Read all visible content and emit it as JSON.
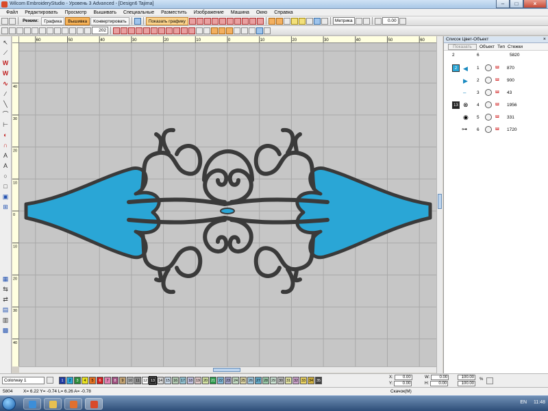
{
  "window": {
    "title": "Wilcom EmbroideryStudio - Уровень 3 Advanced - [Design6 Tajima]"
  },
  "menu": [
    "Файл",
    "Редактировать",
    "Просмотр",
    "Вышивать",
    "Специальные",
    "Разместить",
    "Изображение",
    "Машина",
    "Окно",
    "Справка"
  ],
  "toolbar1": {
    "mode_label": "Режим:",
    "mode_graphics": "Графика",
    "mode_embroidery": "Вышивка",
    "convert": "Конвертировать",
    "show_graphics": "Показать графику",
    "units": "Метрика",
    "value": "0.00"
  },
  "toolbar2": {
    "zoom": "202"
  },
  "ruler": {
    "h_labels": [
      "-70",
      "-60",
      "-50",
      "-40",
      "-30",
      "-20",
      "-10",
      "0",
      "10",
      "20",
      "30",
      "40",
      "50",
      "60",
      "70"
    ],
    "v_labels": [
      "-40",
      "-30",
      "-20",
      "-10",
      "0",
      "10",
      "20",
      "30",
      "40",
      "50",
      "60"
    ]
  },
  "docker": {
    "title": "Список Цвет-Объект",
    "show_button": "Показать",
    "col_object": "Объект",
    "col_type": "Тип",
    "col_stitches": "Стежки",
    "total_count": "2",
    "total_objects": "6",
    "total_stitches": "5820",
    "groups": [
      {
        "color_num": "2",
        "color": "#2aa6d6",
        "items": [
          {
            "num": "1",
            "stitches": "870"
          },
          {
            "num": "2",
            "stitches": "900"
          },
          {
            "num": "3",
            "stitches": "43"
          }
        ]
      },
      {
        "color_num": "13",
        "color": "#222222",
        "items": [
          {
            "num": "4",
            "stitches": "1956"
          },
          {
            "num": "5",
            "stitches": "331"
          },
          {
            "num": "6",
            "stitches": "1720"
          }
        ]
      }
    ]
  },
  "colorbar": {
    "colorway": "Colorway 1",
    "swatches": [
      {
        "n": "1",
        "c": "#1f3aa0"
      },
      {
        "n": "2",
        "c": "#2aa6d6"
      },
      {
        "n": "3",
        "c": "#2d8a3a"
      },
      {
        "n": "4",
        "c": "#e8e020"
      },
      {
        "n": "5",
        "c": "#e07020"
      },
      {
        "n": "6",
        "c": "#d02020"
      },
      {
        "n": "7",
        "c": "#e080b0"
      },
      {
        "n": "8",
        "c": "#a05080"
      },
      {
        "n": "9",
        "c": "#c0a070"
      },
      {
        "n": "10",
        "c": "#b0b0b0"
      },
      {
        "n": "11",
        "c": "#909090"
      },
      {
        "n": "12",
        "c": "#ffffff"
      },
      {
        "n": "13",
        "c": "#222222"
      },
      {
        "n": "14",
        "c": "#d8d8d8"
      },
      {
        "n": "15",
        "c": "#c8d8e8"
      },
      {
        "n": "16",
        "c": "#b0c8b0"
      },
      {
        "n": "17",
        "c": "#90c0d0"
      },
      {
        "n": "18",
        "c": "#c0c0e0"
      },
      {
        "n": "19",
        "c": "#e0c8c8"
      },
      {
        "n": "20",
        "c": "#d0e0a0"
      },
      {
        "n": "21",
        "c": "#2a9a4a"
      },
      {
        "n": "22",
        "c": "#80b8d8"
      },
      {
        "n": "23",
        "c": "#a0a0c8"
      },
      {
        "n": "24",
        "c": "#c0d8c0"
      },
      {
        "n": "25",
        "c": "#d8d0a0"
      },
      {
        "n": "26",
        "c": "#a0c8e0"
      },
      {
        "n": "27",
        "c": "#60a8c8"
      },
      {
        "n": "28",
        "c": "#98c8a8"
      },
      {
        "n": "29",
        "c": "#c8e0d0"
      },
      {
        "n": "30",
        "c": "#b8b8b8"
      },
      {
        "n": "31",
        "c": "#e0e0a0"
      },
      {
        "n": "32",
        "c": "#c8a0c8"
      },
      {
        "n": "33",
        "c": "#e8d060"
      },
      {
        "n": "34",
        "c": "#d0b040"
      },
      {
        "n": "35",
        "c": "#404040"
      }
    ],
    "x": "0.00",
    "y": "0.00",
    "w": "0.00",
    "h": "0.00",
    "scale_w": "100.00",
    "scale_h": "100.00",
    "labels": {
      "x": "X:",
      "y": "Y:",
      "w": "W:",
      "h": "H:",
      "pct": "%"
    }
  },
  "status": {
    "count": "5804",
    "coords": "X=  6.22 Y=  -0.74 L=  6.26 A=  -0.78",
    "hint": "Скачок(M)"
  },
  "tray": {
    "lang": "EN",
    "time": "11:48"
  },
  "colors": {
    "fill": "#2aa6d6",
    "outline": "#3a3a3a",
    "canvas": "#c6c6c6"
  }
}
